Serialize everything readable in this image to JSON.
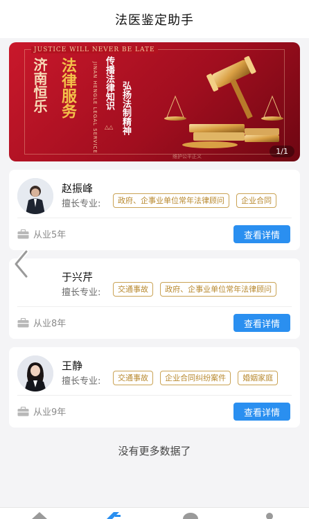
{
  "header": {
    "title": "法医鉴定助手"
  },
  "banner": {
    "motto": "JUSTICE WILL NEVER BE LATE",
    "city": "济南恒乐",
    "service": "法律服务",
    "eng_tag": "JINAN HENGLE LEGAL SERVICE",
    "slogan1": "传播法律知识",
    "slogan2": "弘扬法制精神",
    "deco": "△△",
    "watermark": "维护公平正义",
    "indicator": "1/1"
  },
  "lawyers": [
    {
      "name": "赵振峰",
      "spec_label": "擅长专业:",
      "tags": [
        "政府、企事业单位常年法律顾问",
        "企业合同"
      ],
      "years": "从业5年",
      "button": "查看详情"
    },
    {
      "name": "于兴芹",
      "spec_label": "擅长专业:",
      "tags": [
        "交通事故",
        "政府、企事业单位常年法律顾问"
      ],
      "years": "从业8年",
      "button": "查看详情"
    },
    {
      "name": "王静",
      "spec_label": "擅长专业:",
      "tags": [
        "交通事故",
        "企业合同纠纷案件",
        "婚姻家庭"
      ],
      "years": "从业9年",
      "button": "查看详情"
    }
  ],
  "footer": {
    "no_more": "没有更多数据了"
  },
  "colors": {
    "accent": "#2a8ff0",
    "tag_border": "#c9a253",
    "banner_red": "#c9182b"
  },
  "icons": {
    "briefcase": "briefcase-icon",
    "back": "chevron-left-icon"
  }
}
